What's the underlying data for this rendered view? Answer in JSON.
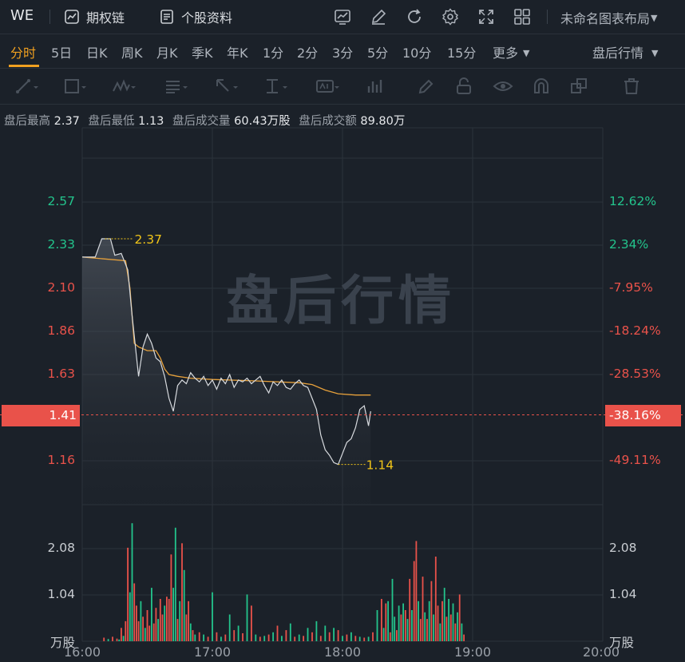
{
  "header": {
    "symbol": "WE",
    "options_chain": "期权链",
    "profile": "个股资料",
    "layout": "未命名图表布局"
  },
  "icons": [
    "chart-line-icon",
    "pencil-icon",
    "refresh-icon",
    "gear-icon",
    "fullscreen-icon",
    "grid-icon"
  ],
  "timeframes": [
    "分时",
    "5日",
    "日K",
    "周K",
    "月K",
    "季K",
    "年K",
    "1分",
    "2分",
    "3分",
    "5分",
    "10分",
    "15分",
    "更多"
  ],
  "active_timeframe": "分时",
  "session": "盘后行情",
  "tools": [
    "trendline-tool",
    "rectangle-tool",
    "wave-tool",
    "fib-tool",
    "arrow-tool",
    "measure-tool",
    "text-tool",
    "indicator-tool",
    "pen-tool",
    "lock-tool",
    "eye-tool",
    "magnet-tool",
    "layers-tool",
    "trash-tool"
  ],
  "stats": {
    "high_label": "盘后最高",
    "high": "2.37",
    "low_label": "盘后最低",
    "low": "1.13",
    "vol_label": "盘后成交量",
    "vol": "60.43万股",
    "amt_label": "盘后成交额",
    "amt": "89.80万"
  },
  "watermark": "盘后行情",
  "colors": {
    "up": "#e9524a",
    "down": "#23c48c",
    "price": "#d8dbdf",
    "avg": "#e7a13b",
    "accent": "#f0a020"
  },
  "chart_data": {
    "type": "line",
    "price_axis": [
      "2.57",
      "2.33",
      "2.10",
      "1.86",
      "1.63",
      "1.41",
      "1.16"
    ],
    "pct_axis": [
      "12.62%",
      "2.34%",
      "-7.95%",
      "-18.24%",
      "-28.53%",
      "-38.16%",
      "-49.11%"
    ],
    "ylim": [
      1.16,
      2.57
    ],
    "x_ticks": [
      "16:00",
      "17:00",
      "18:00",
      "19:00",
      "20:00"
    ],
    "current_price": "1.41",
    "current_pct": "-38.16%",
    "max_marker": "2.37",
    "min_marker": "1.14",
    "price": [
      [
        0,
        2.27
      ],
      [
        6,
        2.27
      ],
      [
        9,
        2.37
      ],
      [
        13,
        2.37
      ],
      [
        15,
        2.28
      ],
      [
        18,
        2.29
      ],
      [
        21,
        2.2
      ],
      [
        23,
        1.95
      ],
      [
        26,
        1.62
      ],
      [
        28,
        1.78
      ],
      [
        30,
        1.85
      ],
      [
        32,
        1.8
      ],
      [
        34,
        1.72
      ],
      [
        36,
        1.7
      ],
      [
        38,
        1.62
      ],
      [
        40,
        1.5
      ],
      [
        42,
        1.43
      ],
      [
        44,
        1.57
      ],
      [
        46,
        1.6
      ],
      [
        48,
        1.58
      ],
      [
        50,
        1.64
      ],
      [
        52,
        1.61
      ],
      [
        54,
        1.59
      ],
      [
        56,
        1.62
      ],
      [
        58,
        1.57
      ],
      [
        60,
        1.6
      ],
      [
        62,
        1.55
      ],
      [
        64,
        1.61
      ],
      [
        66,
        1.58
      ],
      [
        68,
        1.63
      ],
      [
        70,
        1.56
      ],
      [
        72,
        1.6
      ],
      [
        74,
        1.59
      ],
      [
        76,
        1.61
      ],
      [
        78,
        1.58
      ],
      [
        80,
        1.6
      ],
      [
        82,
        1.62
      ],
      [
        84,
        1.57
      ],
      [
        86,
        1.53
      ],
      [
        88,
        1.59
      ],
      [
        90,
        1.57
      ],
      [
        92,
        1.6
      ],
      [
        94,
        1.56
      ],
      [
        96,
        1.55
      ],
      [
        98,
        1.58
      ],
      [
        100,
        1.6
      ],
      [
        102,
        1.57
      ],
      [
        104,
        1.56
      ],
      [
        106,
        1.5
      ],
      [
        108,
        1.44
      ],
      [
        110,
        1.3
      ],
      [
        112,
        1.22
      ],
      [
        114,
        1.19
      ],
      [
        116,
        1.15
      ],
      [
        118,
        1.14
      ],
      [
        120,
        1.2
      ],
      [
        122,
        1.26
      ],
      [
        124,
        1.28
      ],
      [
        126,
        1.34
      ],
      [
        128,
        1.44
      ],
      [
        130,
        1.46
      ],
      [
        132,
        1.35
      ],
      [
        133,
        1.43
      ]
    ],
    "average": [
      [
        0,
        2.27
      ],
      [
        20,
        2.25
      ],
      [
        22,
        2.1
      ],
      [
        24,
        1.8
      ],
      [
        26,
        1.78
      ],
      [
        30,
        1.76
      ],
      [
        34,
        1.76
      ],
      [
        36,
        1.72
      ],
      [
        38,
        1.66
      ],
      [
        40,
        1.63
      ],
      [
        44,
        1.62
      ],
      [
        50,
        1.61
      ],
      [
        60,
        1.603
      ],
      [
        80,
        1.595
      ],
      [
        100,
        1.585
      ],
      [
        106,
        1.575
      ],
      [
        112,
        1.545
      ],
      [
        118,
        1.525
      ],
      [
        126,
        1.518
      ],
      [
        133,
        1.518
      ]
    ],
    "volume_axis": [
      "2.08",
      "1.04"
    ],
    "volume_unit": "万股",
    "volume": [
      [
        10,
        0.08,
        "u"
      ],
      [
        12,
        0.05,
        "d"
      ],
      [
        14,
        0.1,
        "u"
      ],
      [
        16,
        0.06,
        "u"
      ],
      [
        17,
        0.04,
        "d"
      ],
      [
        18,
        0.3,
        "u"
      ],
      [
        19,
        0.12,
        "d"
      ],
      [
        20,
        0.45,
        "u"
      ],
      [
        21,
        2.1,
        "u"
      ],
      [
        22,
        1.1,
        "d"
      ],
      [
        23,
        2.65,
        "d"
      ],
      [
        24,
        1.3,
        "u"
      ],
      [
        25,
        0.8,
        "u"
      ],
      [
        26,
        0.45,
        "u"
      ],
      [
        27,
        0.9,
        "d"
      ],
      [
        28,
        0.55,
        "u"
      ],
      [
        29,
        0.3,
        "d"
      ],
      [
        30,
        0.7,
        "u"
      ],
      [
        31,
        0.35,
        "u"
      ],
      [
        32,
        1.2,
        "d"
      ],
      [
        33,
        0.4,
        "u"
      ],
      [
        34,
        0.75,
        "u"
      ],
      [
        35,
        0.5,
        "d"
      ],
      [
        36,
        0.95,
        "u"
      ],
      [
        37,
        0.6,
        "u"
      ],
      [
        38,
        0.8,
        "d"
      ],
      [
        39,
        1.0,
        "u"
      ],
      [
        40,
        0.95,
        "u"
      ],
      [
        41,
        1.95,
        "u"
      ],
      [
        42,
        1.2,
        "d"
      ],
      [
        43,
        2.55,
        "d"
      ],
      [
        44,
        0.5,
        "u"
      ],
      [
        45,
        0.9,
        "d"
      ],
      [
        46,
        2.2,
        "u"
      ],
      [
        47,
        1.6,
        "d"
      ],
      [
        48,
        0.6,
        "u"
      ],
      [
        49,
        0.9,
        "u"
      ],
      [
        50,
        0.4,
        "d"
      ],
      [
        51,
        0.25,
        "u"
      ],
      [
        52,
        0.15,
        "d"
      ],
      [
        54,
        0.2,
        "u"
      ],
      [
        56,
        0.15,
        "d"
      ],
      [
        58,
        0.1,
        "u"
      ],
      [
        60,
        1.1,
        "d"
      ],
      [
        62,
        0.2,
        "u"
      ],
      [
        64,
        0.1,
        "d"
      ],
      [
        66,
        0.15,
        "u"
      ],
      [
        68,
        0.6,
        "d"
      ],
      [
        70,
        0.25,
        "u"
      ],
      [
        72,
        0.35,
        "d"
      ],
      [
        74,
        0.18,
        "u"
      ],
      [
        76,
        1.05,
        "d"
      ],
      [
        78,
        0.8,
        "u"
      ],
      [
        80,
        0.15,
        "d"
      ],
      [
        82,
        0.1,
        "u"
      ],
      [
        84,
        0.12,
        "d"
      ],
      [
        86,
        0.15,
        "u"
      ],
      [
        88,
        0.2,
        "d"
      ],
      [
        90,
        0.35,
        "u"
      ],
      [
        92,
        0.12,
        "d"
      ],
      [
        94,
        0.25,
        "u"
      ],
      [
        96,
        0.4,
        "d"
      ],
      [
        98,
        0.1,
        "u"
      ],
      [
        100,
        0.15,
        "d"
      ],
      [
        102,
        0.12,
        "u"
      ],
      [
        104,
        0.3,
        "d"
      ],
      [
        106,
        0.2,
        "u"
      ],
      [
        108,
        0.45,
        "d"
      ],
      [
        110,
        0.12,
        "u"
      ],
      [
        112,
        0.35,
        "d"
      ],
      [
        114,
        0.2,
        "u"
      ],
      [
        116,
        0.3,
        "d"
      ],
      [
        118,
        0.25,
        "u"
      ],
      [
        120,
        0.12,
        "d"
      ],
      [
        122,
        0.15,
        "u"
      ],
      [
        124,
        0.2,
        "d"
      ],
      [
        126,
        0.12,
        "u"
      ],
      [
        128,
        0.1,
        "d"
      ],
      [
        130,
        0.08,
        "u"
      ],
      [
        132,
        0.1,
        "d"
      ],
      [
        134,
        0.2,
        "u"
      ],
      [
        136,
        0.7,
        "d"
      ],
      [
        138,
        0.95,
        "u"
      ],
      [
        139,
        0.3,
        "d"
      ],
      [
        140,
        0.85,
        "u"
      ],
      [
        141,
        0.9,
        "d"
      ],
      [
        142,
        0.2,
        "u"
      ],
      [
        143,
        1.4,
        "d"
      ],
      [
        144,
        0.55,
        "d"
      ],
      [
        145,
        0.25,
        "u"
      ],
      [
        146,
        0.8,
        "d"
      ],
      [
        147,
        0.6,
        "u"
      ],
      [
        148,
        0.85,
        "d"
      ],
      [
        149,
        0.7,
        "u"
      ],
      [
        150,
        0.5,
        "d"
      ],
      [
        151,
        1.4,
        "u"
      ],
      [
        152,
        0.7,
        "d"
      ],
      [
        153,
        1.8,
        "u"
      ],
      [
        154,
        2.25,
        "u"
      ],
      [
        155,
        0.9,
        "d"
      ],
      [
        156,
        0.5,
        "u"
      ],
      [
        157,
        1.45,
        "u"
      ],
      [
        158,
        0.65,
        "d"
      ],
      [
        159,
        0.5,
        "u"
      ],
      [
        160,
        0.9,
        "d"
      ],
      [
        161,
        1.35,
        "u"
      ],
      [
        162,
        0.6,
        "d"
      ],
      [
        163,
        1.9,
        "u"
      ],
      [
        164,
        0.8,
        "u"
      ],
      [
        165,
        0.4,
        "d"
      ],
      [
        166,
        0.9,
        "u"
      ],
      [
        167,
        1.2,
        "d"
      ],
      [
        168,
        0.55,
        "u"
      ],
      [
        169,
        0.95,
        "d"
      ],
      [
        170,
        0.6,
        "u"
      ],
      [
        171,
        0.85,
        "d"
      ],
      [
        172,
        0.4,
        "u"
      ],
      [
        173,
        0.65,
        "d"
      ],
      [
        174,
        1.05,
        "u"
      ],
      [
        175,
        0.4,
        "d"
      ],
      [
        176,
        0.15,
        "u"
      ]
    ]
  }
}
